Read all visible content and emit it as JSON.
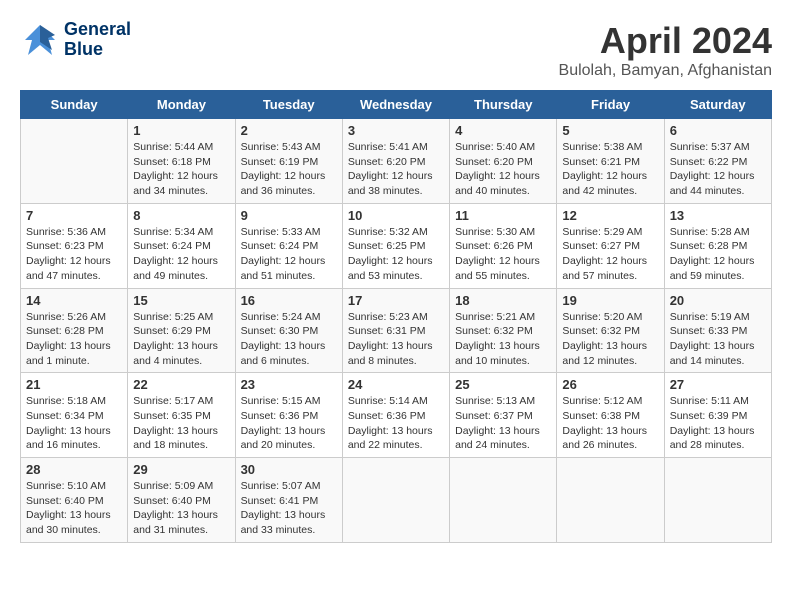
{
  "logo": {
    "line1": "General",
    "line2": "Blue"
  },
  "title": "April 2024",
  "location": "Bulolah, Bamyan, Afghanistan",
  "days_of_week": [
    "Sunday",
    "Monday",
    "Tuesday",
    "Wednesday",
    "Thursday",
    "Friday",
    "Saturday"
  ],
  "weeks": [
    [
      {
        "day": "",
        "info": ""
      },
      {
        "day": "1",
        "info": "Sunrise: 5:44 AM\nSunset: 6:18 PM\nDaylight: 12 hours\nand 34 minutes."
      },
      {
        "day": "2",
        "info": "Sunrise: 5:43 AM\nSunset: 6:19 PM\nDaylight: 12 hours\nand 36 minutes."
      },
      {
        "day": "3",
        "info": "Sunrise: 5:41 AM\nSunset: 6:20 PM\nDaylight: 12 hours\nand 38 minutes."
      },
      {
        "day": "4",
        "info": "Sunrise: 5:40 AM\nSunset: 6:20 PM\nDaylight: 12 hours\nand 40 minutes."
      },
      {
        "day": "5",
        "info": "Sunrise: 5:38 AM\nSunset: 6:21 PM\nDaylight: 12 hours\nand 42 minutes."
      },
      {
        "day": "6",
        "info": "Sunrise: 5:37 AM\nSunset: 6:22 PM\nDaylight: 12 hours\nand 44 minutes."
      }
    ],
    [
      {
        "day": "7",
        "info": "Sunrise: 5:36 AM\nSunset: 6:23 PM\nDaylight: 12 hours\nand 47 minutes."
      },
      {
        "day": "8",
        "info": "Sunrise: 5:34 AM\nSunset: 6:24 PM\nDaylight: 12 hours\nand 49 minutes."
      },
      {
        "day": "9",
        "info": "Sunrise: 5:33 AM\nSunset: 6:24 PM\nDaylight: 12 hours\nand 51 minutes."
      },
      {
        "day": "10",
        "info": "Sunrise: 5:32 AM\nSunset: 6:25 PM\nDaylight: 12 hours\nand 53 minutes."
      },
      {
        "day": "11",
        "info": "Sunrise: 5:30 AM\nSunset: 6:26 PM\nDaylight: 12 hours\nand 55 minutes."
      },
      {
        "day": "12",
        "info": "Sunrise: 5:29 AM\nSunset: 6:27 PM\nDaylight: 12 hours\nand 57 minutes."
      },
      {
        "day": "13",
        "info": "Sunrise: 5:28 AM\nSunset: 6:28 PM\nDaylight: 12 hours\nand 59 minutes."
      }
    ],
    [
      {
        "day": "14",
        "info": "Sunrise: 5:26 AM\nSunset: 6:28 PM\nDaylight: 13 hours\nand 1 minute."
      },
      {
        "day": "15",
        "info": "Sunrise: 5:25 AM\nSunset: 6:29 PM\nDaylight: 13 hours\nand 4 minutes."
      },
      {
        "day": "16",
        "info": "Sunrise: 5:24 AM\nSunset: 6:30 PM\nDaylight: 13 hours\nand 6 minutes."
      },
      {
        "day": "17",
        "info": "Sunrise: 5:23 AM\nSunset: 6:31 PM\nDaylight: 13 hours\nand 8 minutes."
      },
      {
        "day": "18",
        "info": "Sunrise: 5:21 AM\nSunset: 6:32 PM\nDaylight: 13 hours\nand 10 minutes."
      },
      {
        "day": "19",
        "info": "Sunrise: 5:20 AM\nSunset: 6:32 PM\nDaylight: 13 hours\nand 12 minutes."
      },
      {
        "day": "20",
        "info": "Sunrise: 5:19 AM\nSunset: 6:33 PM\nDaylight: 13 hours\nand 14 minutes."
      }
    ],
    [
      {
        "day": "21",
        "info": "Sunrise: 5:18 AM\nSunset: 6:34 PM\nDaylight: 13 hours\nand 16 minutes."
      },
      {
        "day": "22",
        "info": "Sunrise: 5:17 AM\nSunset: 6:35 PM\nDaylight: 13 hours\nand 18 minutes."
      },
      {
        "day": "23",
        "info": "Sunrise: 5:15 AM\nSunset: 6:36 PM\nDaylight: 13 hours\nand 20 minutes."
      },
      {
        "day": "24",
        "info": "Sunrise: 5:14 AM\nSunset: 6:36 PM\nDaylight: 13 hours\nand 22 minutes."
      },
      {
        "day": "25",
        "info": "Sunrise: 5:13 AM\nSunset: 6:37 PM\nDaylight: 13 hours\nand 24 minutes."
      },
      {
        "day": "26",
        "info": "Sunrise: 5:12 AM\nSunset: 6:38 PM\nDaylight: 13 hours\nand 26 minutes."
      },
      {
        "day": "27",
        "info": "Sunrise: 5:11 AM\nSunset: 6:39 PM\nDaylight: 13 hours\nand 28 minutes."
      }
    ],
    [
      {
        "day": "28",
        "info": "Sunrise: 5:10 AM\nSunset: 6:40 PM\nDaylight: 13 hours\nand 30 minutes."
      },
      {
        "day": "29",
        "info": "Sunrise: 5:09 AM\nSunset: 6:40 PM\nDaylight: 13 hours\nand 31 minutes."
      },
      {
        "day": "30",
        "info": "Sunrise: 5:07 AM\nSunset: 6:41 PM\nDaylight: 13 hours\nand 33 minutes."
      },
      {
        "day": "",
        "info": ""
      },
      {
        "day": "",
        "info": ""
      },
      {
        "day": "",
        "info": ""
      },
      {
        "day": "",
        "info": ""
      }
    ]
  ]
}
